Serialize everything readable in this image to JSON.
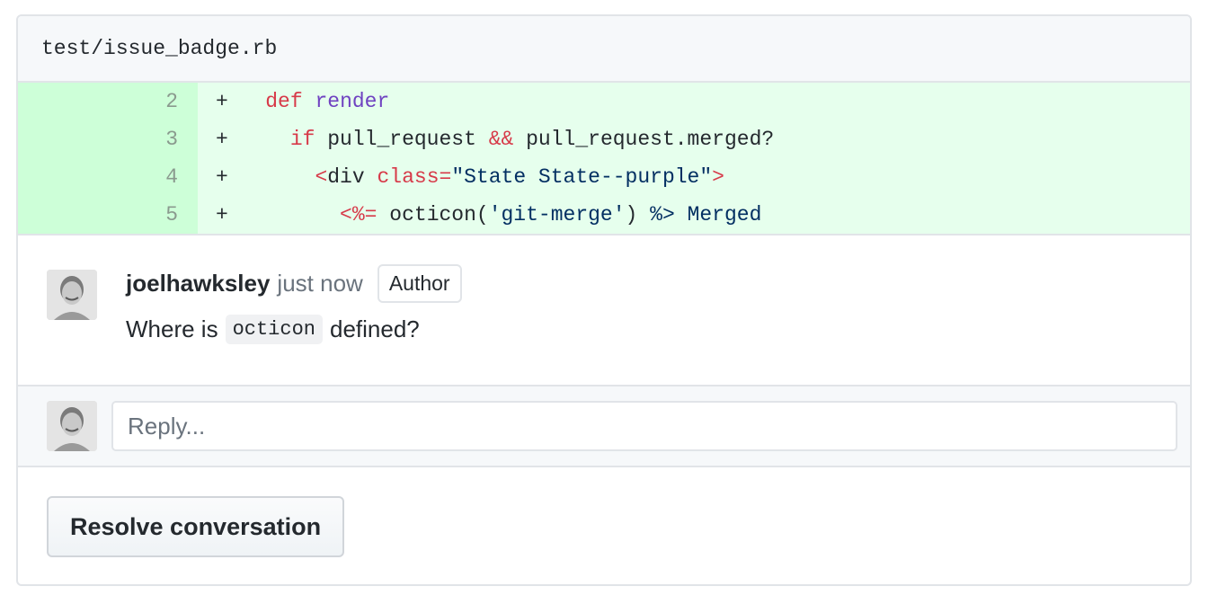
{
  "file": {
    "path": "test/issue_badge.rb"
  },
  "diff": {
    "lines": [
      {
        "number": "2",
        "marker": "+"
      },
      {
        "number": "3",
        "marker": "+"
      },
      {
        "number": "4",
        "marker": "+"
      },
      {
        "number": "5",
        "marker": "+"
      }
    ],
    "line2": {
      "kw": "def",
      "fn": "render"
    },
    "line3": {
      "kw": "if",
      "a": "pull_request",
      "op": "&&",
      "b": "pull_request.merged?"
    },
    "line4": {
      "open": "<",
      "tag": "div",
      "attr": "class=",
      "value": "\"State State--purple\"",
      "close": ">"
    },
    "line5": {
      "open": "<%=",
      "call": "octicon(",
      "arg": "'git-merge'",
      "paren": ")",
      "close": "%>",
      "text": "Merged"
    }
  },
  "comment": {
    "author": "joelhawksley",
    "time": "just now",
    "badge": "Author",
    "body_before": "Where is",
    "body_code": "octicon",
    "body_after": "defined?"
  },
  "reply": {
    "placeholder": "Reply..."
  },
  "actions": {
    "resolve_label": "Resolve conversation"
  }
}
